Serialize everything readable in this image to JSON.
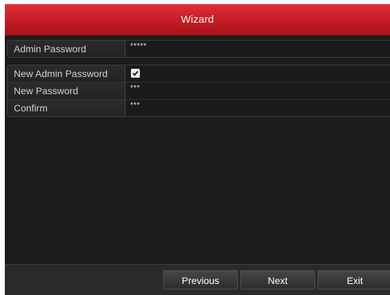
{
  "window": {
    "title": "Wizard"
  },
  "admin": {
    "label": "Admin Password",
    "value": "*****"
  },
  "new_password": {
    "enable_label": "New Admin Password",
    "enabled": true,
    "password_label": "New Password",
    "password_value": "***",
    "confirm_label": "Confirm",
    "confirm_value": "***"
  },
  "buttons": {
    "previous": "Previous",
    "next": "Next",
    "exit": "Exit"
  },
  "colors": {
    "titlebar": "#c41c24",
    "background": "#1c1c1c"
  }
}
